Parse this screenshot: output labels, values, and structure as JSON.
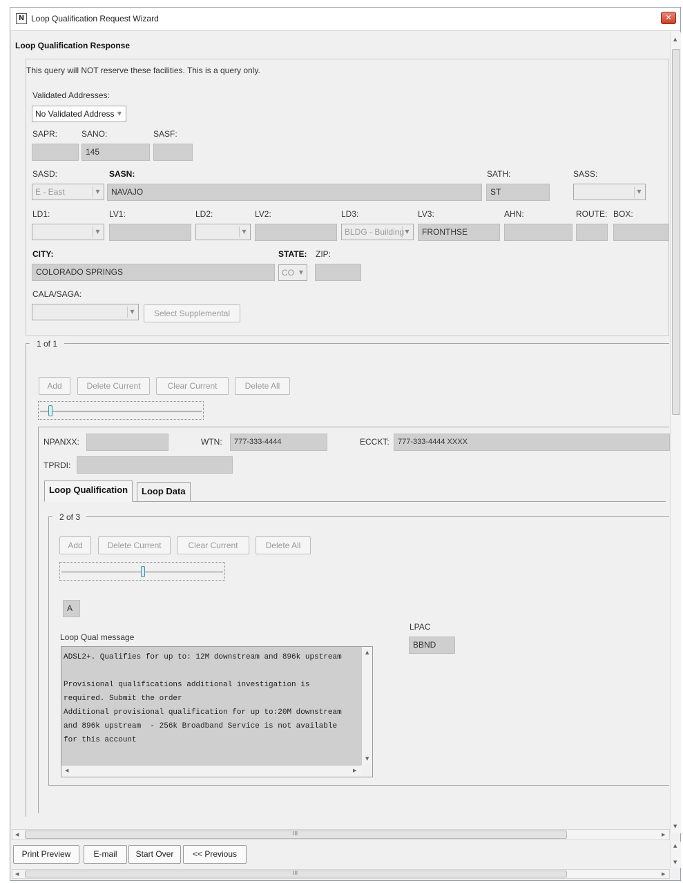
{
  "window": {
    "title": "Loop Qualification Request Wizard",
    "icon_glyph": "N"
  },
  "panel": {
    "title": "Loop Qualification Response"
  },
  "notice": "This query will NOT reserve these facilities.  This is a query only.",
  "address": {
    "validated_label": "Validated Addresses:",
    "validated_value": "No Validated Address",
    "sapr_label": "SAPR:",
    "sapr_value": "",
    "sano_label": "SANO:",
    "sano_value": "145",
    "sasf_label": "SASF:",
    "sasf_value": "",
    "sasd_label": "SASD:",
    "sasd_value": "E - East",
    "sasn_label": "SASN:",
    "sasn_value": "NAVAJO",
    "sath_label": "SATH:",
    "sath_value": "ST",
    "sass_label": "SASS:",
    "sass_value": "",
    "ld1_label": "LD1:",
    "ld1_value": "",
    "lv1_label": "LV1:",
    "lv1_value": "",
    "ld2_label": "LD2:",
    "ld2_value": "",
    "lv2_label": "LV2:",
    "lv2_value": "",
    "ld3_label": "LD3:",
    "ld3_value": "BLDG - Building",
    "lv3_label": "LV3:",
    "lv3_value": "FRONTHSE",
    "ahn_label": "AHN:",
    "ahn_value": "",
    "route_label": "ROUTE:",
    "route_value": "",
    "box_label": "BOX:",
    "box_value": "",
    "city_label": "CITY:",
    "city_value": "COLORADO SPRINGS",
    "state_label": "STATE:",
    "state_value": "CO",
    "zip_label": "ZIP:",
    "zip_value": "",
    "cala_label": "CALA/SAGA:",
    "cala_value": "",
    "supplemental_button": "Select Supplemental"
  },
  "outer_group": {
    "counter": "1 of 1",
    "buttons": {
      "add": "Add",
      "delete_current": "Delete Current",
      "clear_current": "Clear Current",
      "delete_all": "Delete All"
    },
    "slider_position": 0.05,
    "npanxx_label": "NPANXX:",
    "npanxx_value": "",
    "wtn_label": "WTN:",
    "wtn_value": "777-333-4444",
    "ecckt_label": "ECCKT:",
    "ecckt_value": "777-333-4444 XXXX",
    "tprdi_label": "TPRDI:",
    "tprdi_value": ""
  },
  "tabs": [
    {
      "label": "Loop Qualification",
      "active": true
    },
    {
      "label": "Loop Data",
      "active": false
    }
  ],
  "inner_group": {
    "counter": "2 of 3",
    "buttons": {
      "add": "Add",
      "delete_current": "Delete Current",
      "clear_current": "Clear Current",
      "delete_all": "Delete All"
    },
    "slider_position": 0.5,
    "code_value": "A",
    "message_label": "Loop Qual message",
    "message_text": "ADSL2+. Qualifies for up to: 12M downstream and 896k upstream\n\nProvisional qualifications additional investigation is required. Submit the order\nAdditional provisional qualification for up to:20M downstream and 896k upstream  - 256k Broadband Service is not available for this account",
    "lpac_label": "LPAC",
    "lpac_value": "BBND"
  },
  "footer_buttons": {
    "print_preview": "Print Preview",
    "email": "E-mail",
    "start_over": "Start Over",
    "previous": "<< Previous"
  },
  "scrollbar": {
    "grip": "III"
  }
}
